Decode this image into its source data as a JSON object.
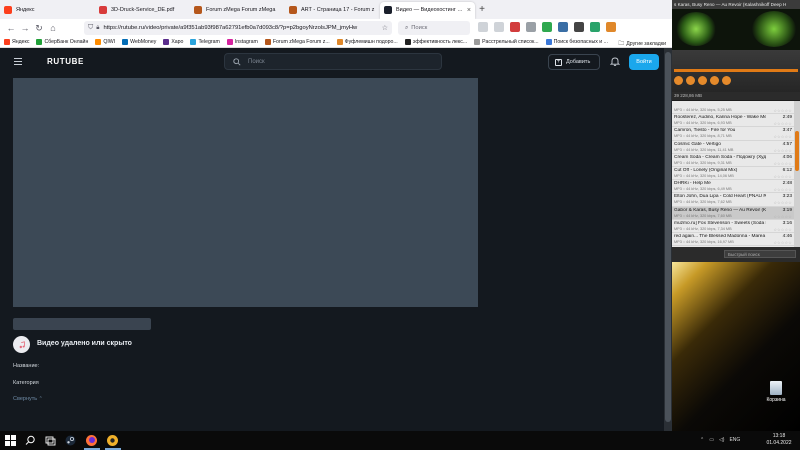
{
  "browser": {
    "tabs": [
      {
        "title": "Яндекс",
        "color": "#fc3f1d",
        "active": false
      },
      {
        "title": "3D-Druck-Service_DE.pdf",
        "color": "#d83b3b",
        "active": false
      },
      {
        "title": "Forum zMega Forum zMega",
        "color": "#b5571c",
        "active": false
      },
      {
        "title": "ART - Страница 17 - Forum z",
        "color": "#b5571c",
        "active": false
      },
      {
        "title": "Видео — Видеохостинг Rutube",
        "color": "#1a1f2b",
        "active": true
      }
    ],
    "new_tab": "+",
    "url": "https://rutube.ru/video/private/a9f351ab93f987a62791efb0a7d093c8/?p=p2bgoyNrzolsJPM_jmyHw",
    "search_placeholder": "Поиск",
    "bookmarks": [
      {
        "label": "Яндекс",
        "color": "#fc3f1d"
      },
      {
        "label": "СберБанк Онлайн",
        "color": "#21a038"
      },
      {
        "label": "QIWI",
        "color": "#ff8c00"
      },
      {
        "label": "WebMoney",
        "color": "#036cb5"
      },
      {
        "label": "Харо",
        "color": "#5a2d8c"
      },
      {
        "label": "Telegram",
        "color": "#2aa3dc"
      },
      {
        "label": "Instagram",
        "color": "#d6249f"
      },
      {
        "label": "Forum zMega Forum z...",
        "color": "#b5571c"
      },
      {
        "label": "Фуфлемишн подоро...",
        "color": "#e0882a"
      },
      {
        "label": "эффективность лекс...",
        "color": "#222222"
      },
      {
        "label": "Расстрельный список...",
        "color": "#9b9b9b"
      },
      {
        "label": "Поиск безопасных и ...",
        "color": "#3b78d8"
      }
    ],
    "bookmarks_other": "Другие закладки"
  },
  "rutube": {
    "logo": "RUTUBE",
    "search_placeholder": "Поиск",
    "add_label": "Добавить",
    "login_label": "Войти",
    "deleted_text": "Видео удалено или скрыто",
    "name_label": "Название:",
    "category_label": "Категория",
    "collapse_label": "Свернуть"
  },
  "aimp": {
    "title": "s Karas, Busy Reno — Au Revoir (Kalashnikoff Deep H",
    "list_header": "39    228,86 MB",
    "quick_search": "Быстрый поиск",
    "tracks": [
      {
        "title": "",
        "info": "MP3 :: 44 kHz, 320 kbps, 5,25 MB",
        "dur": ""
      },
      {
        "title": "Roosterez, Audino, Karina Hope - Wake Me Up",
        "info": "MP3 :: 44 kHz, 320 kbps, 6,93 MB",
        "dur": "2:49"
      },
      {
        "title": "Camron, Tiesto - Fire for You",
        "info": "MP3 :: 44 kHz, 320 kbps, 8,71 MB",
        "dur": "3:47"
      },
      {
        "title": "Cosmic Gate - Vertigo",
        "info": "MP3 :: 44 kHz, 320 kbps, 11,41 MB",
        "dur": "4:57"
      },
      {
        "title": "Cream Soda - Cream Soda - Подожгу (Худож...",
        "info": "MP3 :: 44 kHz, 320 kbps, 9,31 MB",
        "dur": "4:06"
      },
      {
        "title": "Cut Off - Lonely (Original Mix)",
        "info": "MP3 :: 44 kHz, 320 kbps, 14,06 MB",
        "dur": "6:12"
      },
      {
        "title": "DHRKi - Help Me",
        "info": "MP3 :: 44 kHz, 320 kbps, 6,49 MB",
        "dur": "2:48"
      },
      {
        "title": "Elton John, Dua Lipa - Cold Heart (PNAU Remix)",
        "info": "MP3 :: 44 kHz, 320 kbps, 7,62 MB",
        "dur": "3:23"
      },
      {
        "title": "Gabor & Karas, Busy Reno — Au Revoir (Kalas...",
        "info": "MP3 :: 44 kHz, 320 kbps, 7,60 MB",
        "dur": "3:19"
      },
      {
        "title": "muzmo.ru] Fox Stevenson - Sweets (Soda Po...",
        "info": "MP3 :: 44 kHz, 320 kbps, 7,34 MB",
        "dur": "3:16"
      },
      {
        "title": "red again... The Blessed Madonna - Marea (...",
        "info": "MP3 :: 44 kHz, 320 kbps, 16,97 MB",
        "dur": "4:46"
      }
    ],
    "selected_index": 8
  },
  "desktop": {
    "recycle_bin": "Корзина"
  },
  "taskbar": {
    "lang": "ENG",
    "time": "13:18",
    "date": "01.04.2022"
  }
}
